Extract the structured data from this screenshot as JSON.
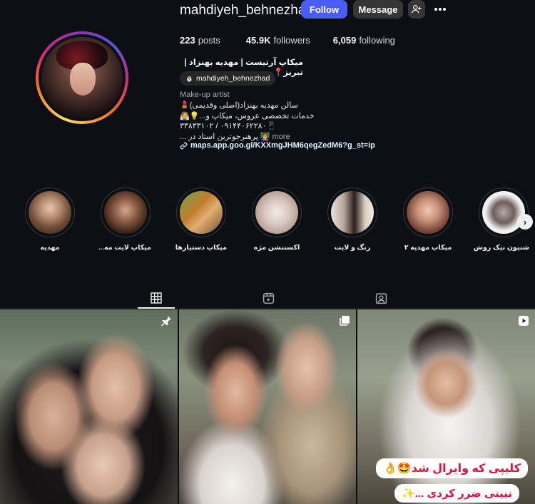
{
  "profile": {
    "username": "mahdiyeh_behnezhad",
    "follow_label": "Follow",
    "message_label": "Message",
    "stats": {
      "posts_count": "223",
      "posts_label": "posts",
      "followers_count": "45.9K",
      "followers_label": "followers",
      "following_count": "6,059",
      "following_label": "following"
    },
    "full_name": "میکاپ آرتیست | مهدیه بهنزاد | تبریز📍",
    "threads_handle": "mahdiyeh_behnezhad",
    "category": "Make-up artist",
    "bio_lines": [
      "سالن مهدیه بهنزاد(اصلی وقدیمی)💄",
      "خدمات تخصصی عروس، میکاپ و...💡👰",
      "📱۰۹۱۴۴۰۶۲۲۸۰ / ۳۳۸۳۳۱۰۲",
      "👩‍🏫 پرهنرجوترین استاد در ..."
    ],
    "more_label": "more",
    "link": "maps.app.goo.gl/KXXmgJHM6qegZedM6?g_st=ip"
  },
  "highlights": [
    {
      "label": "مهدیه"
    },
    {
      "label": "میکاپ لایت مه..."
    },
    {
      "label": "میکاپ دستیارها"
    },
    {
      "label": "اکستنشن مژه"
    },
    {
      "label": "رنگ و لایت"
    },
    {
      "label": "میکاپ مهدیه ۲"
    },
    {
      "label": "شنیون نیک روش"
    }
  ],
  "post_caption": {
    "line1": "کلیپی که وایرال شد🤩👌",
    "line2": "نبینی ضرر کردی ...✨"
  },
  "colors": {
    "follow_button": "#4a5df9",
    "secondary_button": "#363636",
    "background": "#0c0f14",
    "caption_text": "#e0113c"
  },
  "icons": {
    "tab_posts": "grid-icon",
    "tab_reels": "reels-icon",
    "tab_tagged": "tagged-icon",
    "add_user": "add-user-icon",
    "more": "more-dots-icon",
    "threads": "threads-icon",
    "link": "link-icon",
    "pinned": "pin-icon",
    "carousel": "carousel-icon",
    "reel": "reel-icon",
    "next": "chevron-right-icon"
  }
}
